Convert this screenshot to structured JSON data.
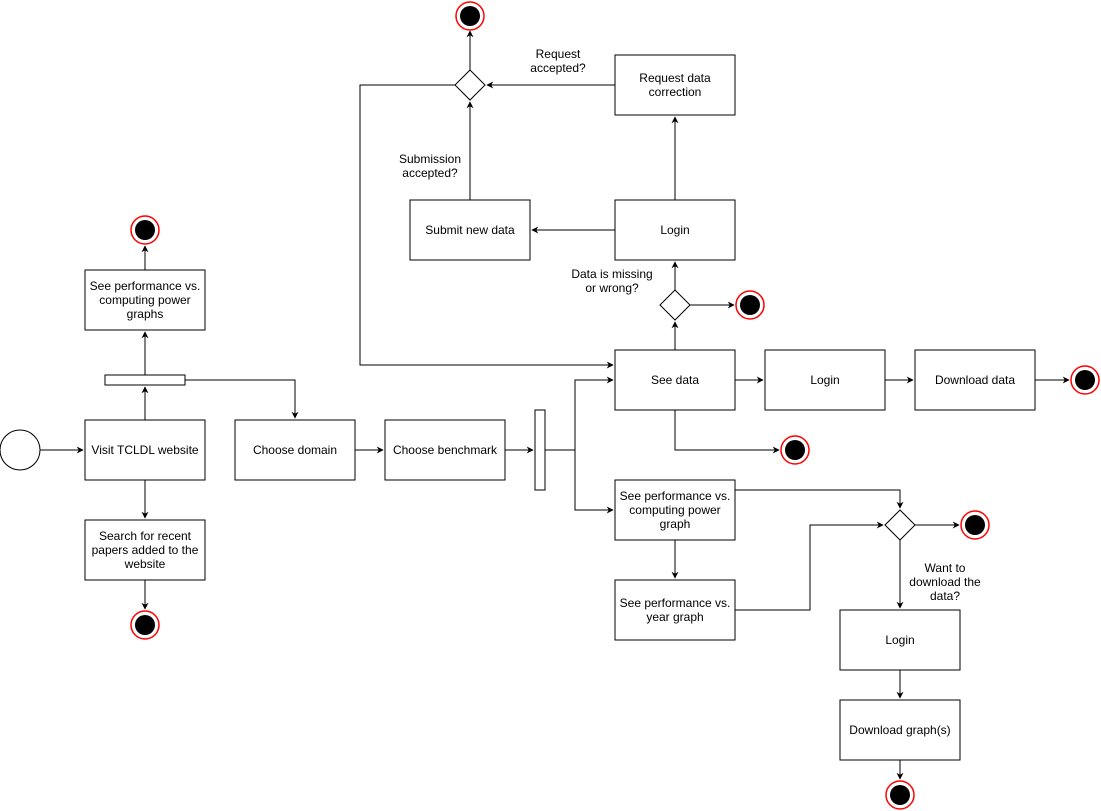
{
  "nodes": {
    "visit": [
      "Visit TCLDL website"
    ],
    "search": [
      "Search for recent",
      "papers added to the",
      "website"
    ],
    "perf_graphs": [
      "See performance vs.",
      "computing power",
      "graphs"
    ],
    "domain": [
      "Choose domain"
    ],
    "benchmark": [
      "Choose benchmark"
    ],
    "see_data": [
      "See data"
    ],
    "login_mid": [
      "Login"
    ],
    "download_data": [
      "Download data"
    ],
    "login_top": [
      "Login"
    ],
    "submit": [
      "Submit new data"
    ],
    "request": [
      "Request data",
      "correction"
    ],
    "perf_comp": [
      "See performance vs.",
      "computing power",
      "graph"
    ],
    "perf_year": [
      "See performance vs.",
      "year graph"
    ],
    "login_graph": [
      "Login"
    ],
    "download_graph": [
      "Download graph(s)"
    ]
  },
  "labels": {
    "request_accepted": [
      "Request",
      "accepted?"
    ],
    "submission_accepted": [
      "Submission",
      "accepted?"
    ],
    "data_missing": [
      "Data is missing",
      "or wrong?"
    ],
    "want_download": [
      "Want to",
      "download the",
      "data?"
    ]
  },
  "colors": {
    "final_ring": "#ff0000",
    "final_fill": "#000000"
  }
}
